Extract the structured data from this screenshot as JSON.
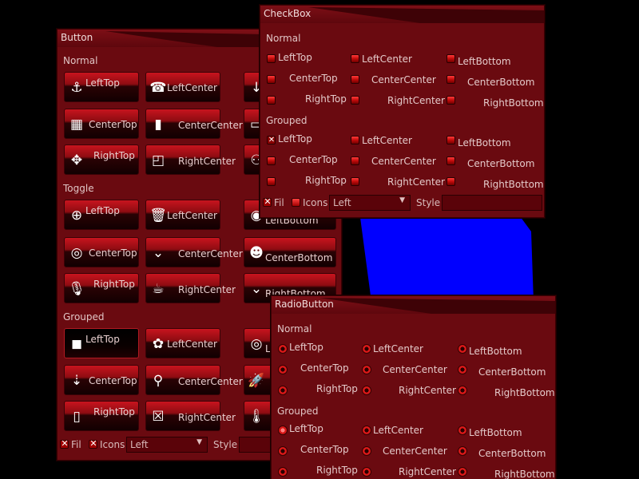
{
  "button_window": {
    "title": "Button",
    "sections": {
      "normal": "Normal",
      "toggle": "Toggle",
      "grouped": "Grouped"
    },
    "normal": [
      {
        "label": "LeftTop",
        "icon": "anchor-icon",
        "glyph": "⚓"
      },
      {
        "label": "LeftCenter",
        "icon": "phone-icon",
        "glyph": "☎"
      },
      {
        "label": "",
        "icon": "arrow-down-icon",
        "glyph": "↓"
      },
      {
        "label": "CenterTop",
        "icon": "building-icon",
        "glyph": "▦"
      },
      {
        "label": "CenterCenter",
        "icon": "bar-chart-icon",
        "glyph": "▮"
      },
      {
        "label": "",
        "icon": "folder-icon",
        "glyph": "▭"
      },
      {
        "label": "RightTop",
        "icon": "expand-icon",
        "glyph": "✥"
      },
      {
        "label": "RightCenter",
        "icon": "note-icon",
        "glyph": "◰"
      },
      {
        "label": "",
        "icon": "binoculars-icon",
        "glyph": "⚇"
      }
    ],
    "normal_ghosts": [
      "Bottom",
      "CenterBottom",
      "RightBottom"
    ],
    "toggle": [
      {
        "label": "LeftTop",
        "icon": "zoom-in-icon",
        "glyph": "⊕"
      },
      {
        "label": "LeftCenter",
        "icon": "trash-icon",
        "glyph": "🗑"
      },
      {
        "label": "LeftBottom",
        "icon": "stop-circle-icon",
        "glyph": "◉"
      },
      {
        "label": "CenterTop",
        "icon": "record-icon",
        "glyph": "◎"
      },
      {
        "label": "CenterCenter",
        "icon": "chevrons-down-icon",
        "glyph": "⌄"
      },
      {
        "label": "CenterBottom",
        "icon": "reddit-icon",
        "glyph": "☻"
      },
      {
        "label": "RightTop",
        "icon": "microphone-slash-icon",
        "glyph": "🎙"
      },
      {
        "label": "RightCenter",
        "icon": "coffee-icon",
        "glyph": "☕"
      },
      {
        "label": "RightBottom",
        "icon": "chevron-down-icon",
        "glyph": "⌄"
      }
    ],
    "grouped": [
      {
        "label": "LeftTop",
        "icon": "stop-icon",
        "glyph": "◼"
      },
      {
        "label": "LeftCenter",
        "icon": "piggy-icon",
        "glyph": "✿"
      },
      {
        "label": "Le",
        "icon": "target-icon",
        "glyph": "◎"
      },
      {
        "label": "CenterTop",
        "icon": "sort-numeric-icon",
        "glyph": "⇣"
      },
      {
        "label": "CenterCenter",
        "icon": "map-pin-icon",
        "glyph": "⚲"
      },
      {
        "label": "",
        "icon": "rocket-icon",
        "glyph": "🚀"
      },
      {
        "label": "RightTop",
        "icon": "mobile-icon",
        "glyph": "▯"
      },
      {
        "label": "RightCenter",
        "icon": "close-box-icon",
        "glyph": "☒"
      },
      {
        "label": "",
        "icon": "thermometer-icon",
        "glyph": "🌡"
      }
    ],
    "bottom": {
      "fill": "Fil",
      "icons": "Icons",
      "align": "Left",
      "style": "Style"
    }
  },
  "checkbox_window": {
    "title": "CheckBox",
    "sections": {
      "normal": "Normal",
      "grouped": "Grouped"
    },
    "normal": [
      "LeftTop",
      "LeftCenter",
      "LeftBottom",
      "CenterTop",
      "CenterCenter",
      "CenterBottom",
      "RightTop",
      "RightCenter",
      "RightBottom"
    ],
    "grouped": [
      "LeftTop",
      "LeftCenter",
      "LeftBottom",
      "CenterTop",
      "CenterCenter",
      "CenterBottom",
      "RightTop",
      "RightCenter",
      "RightBottom"
    ],
    "bottom": {
      "fill": "Fil",
      "icons": "Icons",
      "align": "Left",
      "style": "Style"
    }
  },
  "radio_window": {
    "title": "RadioButton",
    "sections": {
      "normal": "Normal",
      "grouped": "Grouped"
    },
    "normal": [
      "LeftTop",
      "LeftCenter",
      "LeftBottom",
      "CenterTop",
      "CenterCenter",
      "CenterBottom",
      "RightTop",
      "RightCenter",
      "RightBottom"
    ],
    "grouped": [
      "LeftTop",
      "LeftCenter",
      "LeftBottom",
      "CenterTop",
      "CenterCenter",
      "CenterBottom",
      "RightTop",
      "RightCenter",
      "RightBottom"
    ]
  },
  "colors": {
    "background": "#000000",
    "window": "#6a0a10",
    "accent": "#d81818",
    "blue_shape": "#0000ff"
  }
}
